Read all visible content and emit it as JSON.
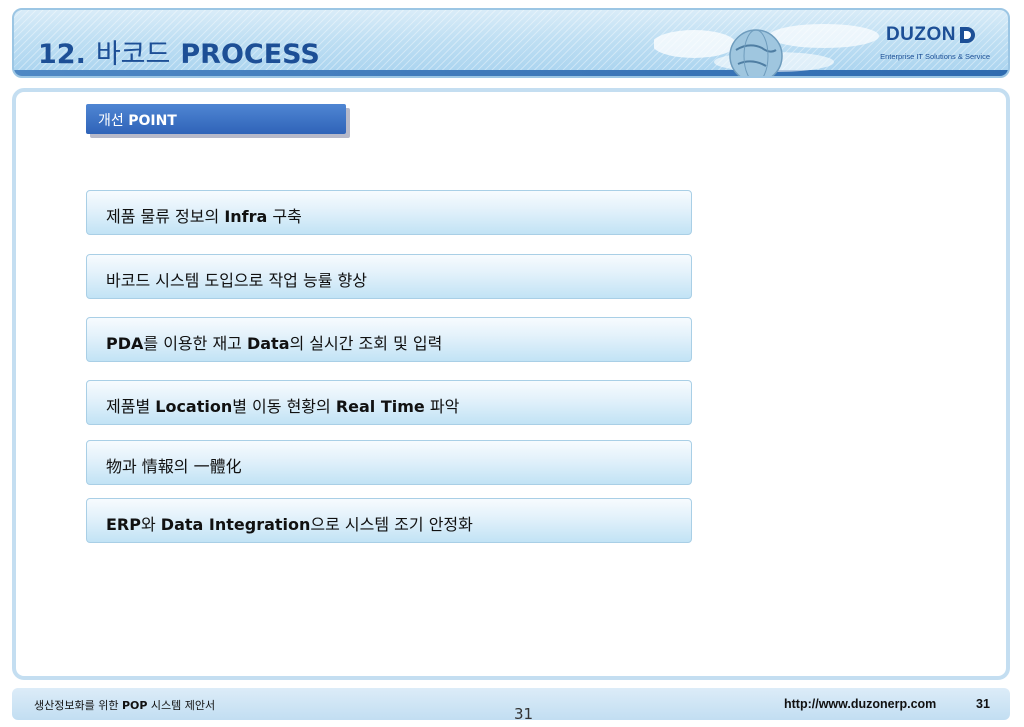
{
  "header": {
    "title_number": "12.",
    "title_korean": "바코드",
    "title_english": "PROCESS",
    "brand": {
      "name": "DUZON",
      "tagline": "Enterprise IT Solutions & Service"
    }
  },
  "point_tab": {
    "label_prefix": "개선",
    "label_strong": "POINT"
  },
  "items": [
    {
      "parts": [
        {
          "t": "제품 물류 정보의 "
        },
        {
          "t": "Infra",
          "b": true
        },
        {
          "t": " 구축"
        }
      ]
    },
    {
      "parts": [
        {
          "t": "바코드 시스템 도입으로 작업 능률 향상"
        }
      ]
    },
    {
      "parts": [
        {
          "t": "PDA",
          "b": true
        },
        {
          "t": "를 이용한 재고 "
        },
        {
          "t": "Data",
          "b": true
        },
        {
          "t": "의 실시간 조회 및 입력"
        }
      ]
    },
    {
      "parts": [
        {
          "t": "제품별 "
        },
        {
          "t": "Location",
          "b": true
        },
        {
          "t": "별 이동 현황의 "
        },
        {
          "t": "Real Time",
          "b": true
        },
        {
          "t": " 파악"
        }
      ]
    },
    {
      "parts": [
        {
          "t": "物과 情報의 一體化"
        }
      ]
    },
    {
      "parts": [
        {
          "t": "ERP",
          "b": true
        },
        {
          "t": "와 "
        },
        {
          "t": "Data Integration",
          "b": true
        },
        {
          "t": "으로 시스템 조기 안정화"
        }
      ]
    }
  ],
  "footer": {
    "left_prefix": "생산정보화를 위한 ",
    "left_strong": "POP",
    "left_suffix": " 시스템 제안서",
    "center_page": "31",
    "url": "http://www.duzonerp.com",
    "right_page": "31"
  },
  "colors": {
    "title": "#1d4f96",
    "tab": "#2f63b8",
    "item_border": "#a9cfe6",
    "panel_border": "#c4def1"
  }
}
